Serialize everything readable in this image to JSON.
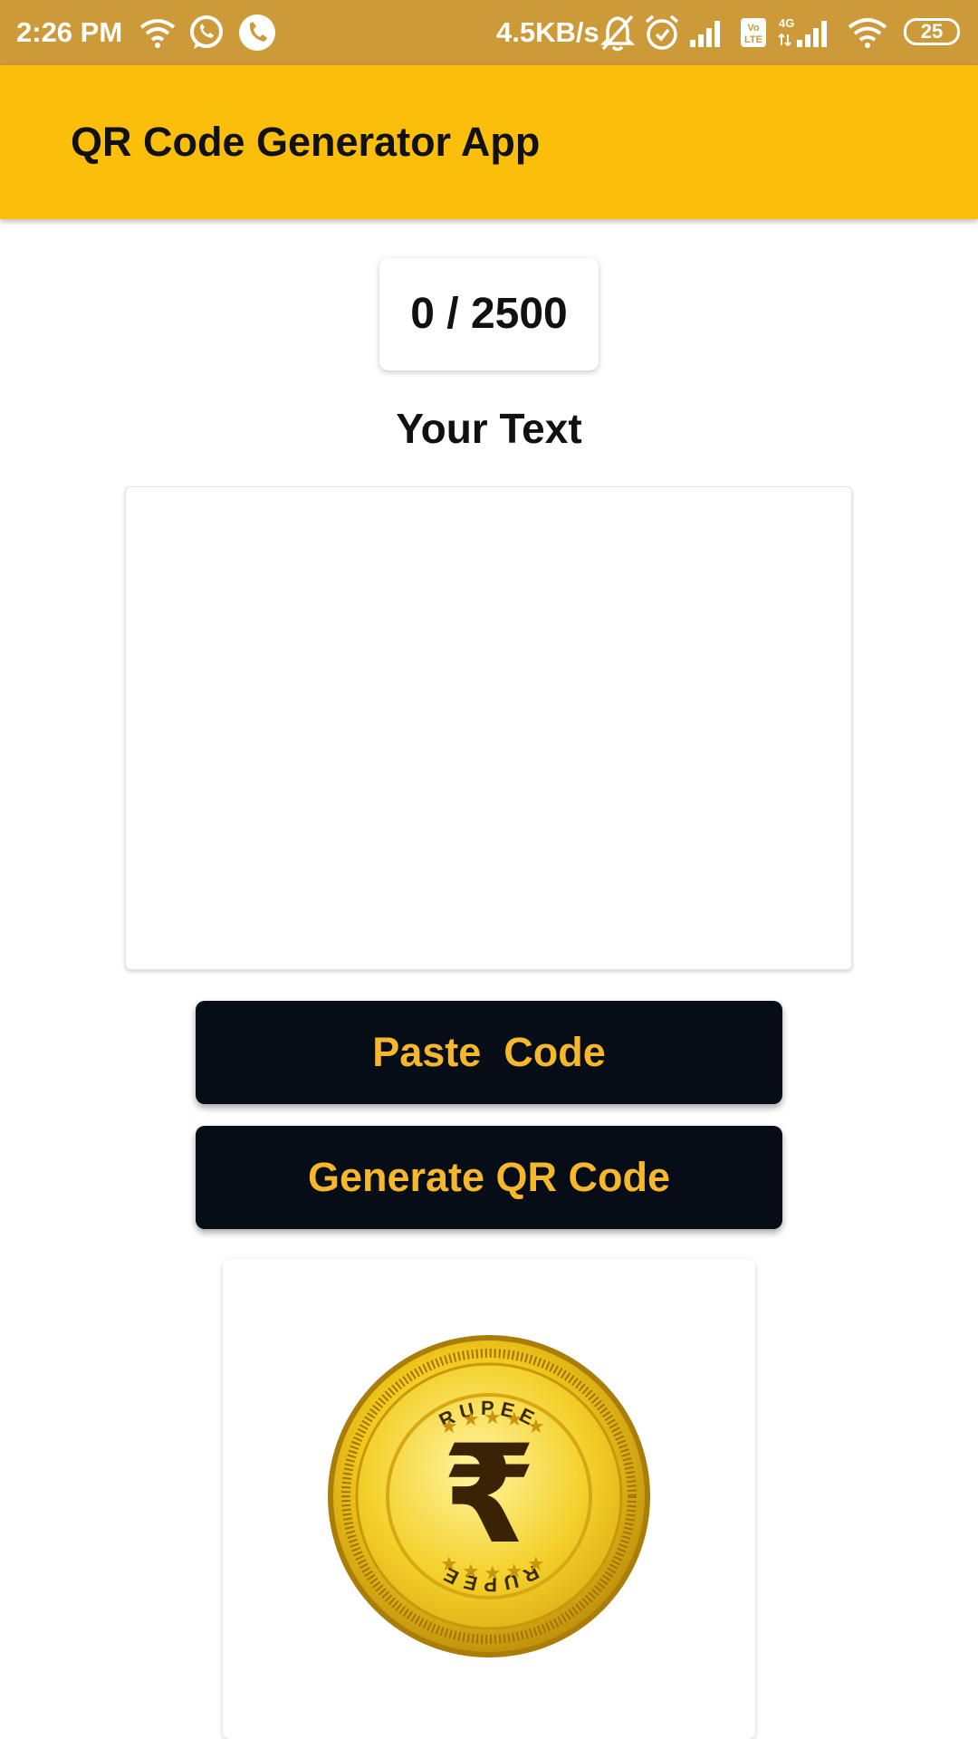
{
  "status_bar": {
    "time": "2:26 PM",
    "net_speed": "4.5KB/s",
    "battery": "25",
    "volte": "Vo\nLTE",
    "network_4g": "4G"
  },
  "app_bar": {
    "title": "QR Code Generator App"
  },
  "counter": {
    "text": "0 / 2500"
  },
  "input_section": {
    "label": "Your Text",
    "value": "",
    "placeholder": ""
  },
  "buttons": {
    "paste": "Paste  Code",
    "generate": "Generate QR Code"
  },
  "coin_image": {
    "top_text": "RUPEE",
    "bottom_text": "RUPEE",
    "symbol": "₹"
  },
  "colors": {
    "status_bar": "#cc9a38",
    "app_bar": "#fbbe0a",
    "button_bg": "#060d16",
    "button_text": "#f6b82a"
  }
}
